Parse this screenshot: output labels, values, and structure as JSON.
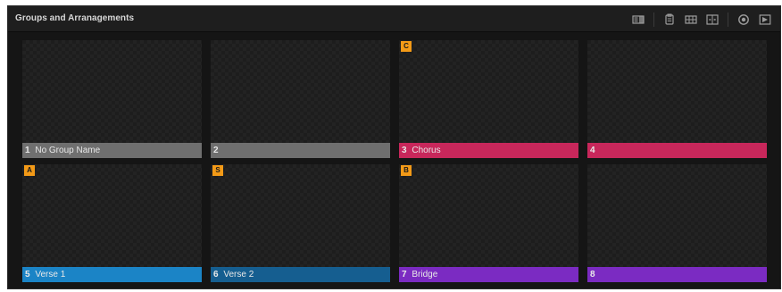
{
  "header": {
    "title": "Groups and Arranagements",
    "toolbar": [
      {
        "icon": "view-toggle-icon"
      },
      {
        "icon": "clipboard-icon"
      },
      {
        "icon": "pattern-grid-icon"
      },
      {
        "icon": "arrange-icon"
      },
      {
        "icon": "settings-icon"
      },
      {
        "icon": "play-next-icon"
      }
    ]
  },
  "groups": [
    {
      "number": "1",
      "name": "No Group Name",
      "badge": "",
      "color": "#6f6f6f"
    },
    {
      "number": "2",
      "name": "",
      "badge": "",
      "color": "#6f6f6f"
    },
    {
      "number": "3",
      "name": "Chorus",
      "badge": "C",
      "color": "#c8275b"
    },
    {
      "number": "4",
      "name": "",
      "badge": "",
      "color": "#c8275b"
    },
    {
      "number": "5",
      "name": "Verse 1",
      "badge": "A",
      "color": "#1b84c6"
    },
    {
      "number": "6",
      "name": "Verse 2",
      "badge": "S",
      "color": "#155e90"
    },
    {
      "number": "7",
      "name": "Bridge",
      "badge": "B",
      "color": "#7b2bc2"
    },
    {
      "number": "8",
      "name": "",
      "badge": "",
      "color": "#7b2bc2"
    }
  ],
  "colors": {
    "badge": "#f39a17",
    "panel": "#151515",
    "header": "#1e1e1e"
  }
}
